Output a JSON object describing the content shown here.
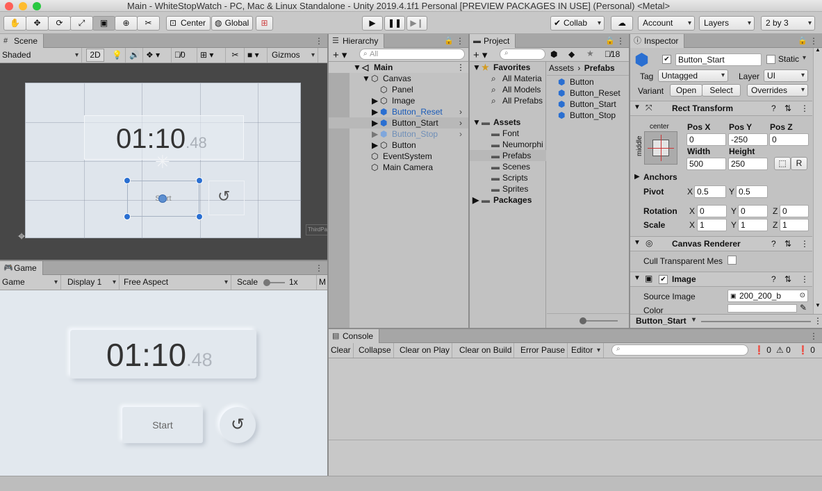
{
  "window": {
    "title": "Main - WhiteStopWatch - PC, Mac & Linux Standalone - Unity 2019.4.1f1 Personal [PREVIEW PACKAGES IN USE] (Personal) <Metal>"
  },
  "toolbar": {
    "pivot_center": "Center",
    "pivot_global": "Global",
    "collab": "Collab",
    "account": "Account",
    "layers": "Layers",
    "layout": "2 by 3"
  },
  "scene": {
    "tab": "Scene",
    "shading": "Shaded",
    "mode_2d": "2D",
    "hidden_count": "0",
    "gizmos": "Gizmos",
    "timer_main": "01:10",
    "timer_ms": ".48",
    "start_label": "Start",
    "third_party": "ThirdPa"
  },
  "game": {
    "tab": "Game",
    "display_menu": "Game",
    "display": "Display 1",
    "aspect": "Free Aspect",
    "scale_label": "Scale",
    "scale_value": "1x",
    "maximize_short": "M",
    "timer_main": "01:10",
    "timer_ms": ".48",
    "start_label": "Start"
  },
  "hierarchy": {
    "tab": "Hierarchy",
    "search_placeholder": "All",
    "items": [
      {
        "label": "Main"
      },
      {
        "label": "Canvas"
      },
      {
        "label": "Panel"
      },
      {
        "label": "Image"
      },
      {
        "label": "Button_Reset"
      },
      {
        "label": "Button_Start"
      },
      {
        "label": "Button_Stop"
      },
      {
        "label": "Button"
      },
      {
        "label": "EventSystem"
      },
      {
        "label": "Main Camera"
      }
    ]
  },
  "project": {
    "tab": "Project",
    "hidden_count": "18",
    "tree": [
      {
        "label": "Favorites"
      },
      {
        "label": "All Materia"
      },
      {
        "label": "All Models"
      },
      {
        "label": "All Prefabs"
      },
      {
        "label": "Assets"
      },
      {
        "label": "Font"
      },
      {
        "label": "Neumorphi"
      },
      {
        "label": "Prefabs"
      },
      {
        "label": "Scenes"
      },
      {
        "label": "Scripts"
      },
      {
        "label": "Sprites"
      },
      {
        "label": "Packages"
      }
    ],
    "breadcrumb": {
      "root": "Assets",
      "current": "Prefabs"
    },
    "files": [
      "Button",
      "Button_Reset",
      "Button_Start",
      "Button_Stop"
    ]
  },
  "inspector": {
    "tab": "Inspector",
    "object_name": "Button_Start",
    "static_label": "Static",
    "tag_label": "Tag",
    "tag_value": "Untagged",
    "layer_label": "Layer",
    "layer_value": "UI",
    "variant_label": "Variant",
    "open_btn": "Open",
    "select_btn": "Select",
    "overrides": "Overrides",
    "rect_transform": {
      "title": "Rect Transform",
      "anchor_h": "center",
      "anchor_v": "middle",
      "posx_label": "Pos X",
      "posy_label": "Pos Y",
      "posz_label": "Pos Z",
      "posx": "0",
      "posy": "-250",
      "posz": "0",
      "width_label": "Width",
      "height_label": "Height",
      "width": "500",
      "height": "250",
      "r_btn": "R",
      "anchors": "Anchors",
      "pivot_label": "Pivot",
      "pivot_x": "0.5",
      "pivot_y": "0.5",
      "rotation_label": "Rotation",
      "rot_x": "0",
      "rot_y": "0",
      "rot_z": "0",
      "scale_label": "Scale",
      "scale_x": "1",
      "scale_y": "1",
      "scale_z": "1",
      "x": "X",
      "y": "Y",
      "z": "Z"
    },
    "canvas_renderer": {
      "title": "Canvas Renderer",
      "cull_label": "Cull Transparent Mes"
    },
    "image": {
      "title": "Image",
      "source_label": "Source Image",
      "source_value": "200_200_b",
      "color_label": "Color"
    },
    "footer_object": "Button_Start"
  },
  "console": {
    "tab": "Console",
    "clear": "Clear",
    "collapse": "Collapse",
    "clear_on_play": "Clear on Play",
    "clear_on_build": "Clear on Build",
    "error_pause": "Error Pause",
    "editor": "Editor",
    "errors": "0",
    "warnings": "0",
    "logs": "0"
  }
}
